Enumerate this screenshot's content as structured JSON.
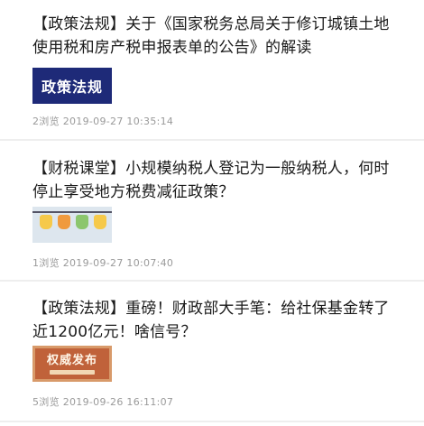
{
  "articles": [
    {
      "title": "【政策法规】关于《国家税务总局关于修订城镇土地使用税和房产税申报表单的公告》的解读",
      "thumbnail_text": "政策法规",
      "meta": "2浏览 2019-09-27 10:35:14"
    },
    {
      "title": "【财税课堂】小规模纳税人登记为一般纳税人，何时停止享受地方税费减征政策？",
      "thumbnail_icons": [
        "light-bulb-icon",
        "light-bulb-icon",
        "light-bulb-icon",
        "light-bulb-icon"
      ],
      "meta": "1浏览 2019-09-27 10:07:40"
    },
    {
      "title": "【政策法规】重磅！财政部大手笔：给社保基金转了近1200亿元！啥信号？",
      "thumbnail_text": "权威发布",
      "meta": "5浏览 2019-09-26 16:11:07"
    }
  ],
  "colors": {
    "title_text": "#1a1a1a",
    "meta_text": "#9a9a9a",
    "divider": "#eeeeee",
    "policy_banner": "#1e2a78",
    "authority_banner": "#c0623a"
  }
}
